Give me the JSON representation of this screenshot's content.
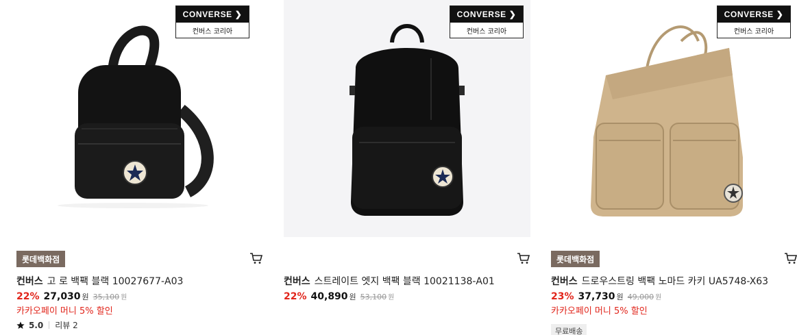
{
  "products": [
    {
      "logo": {
        "brand": "CONVERSE",
        "region": "컨버스 코리아"
      },
      "store_badge": "롯데백화점",
      "brand": "컨버스",
      "name": "고 로 백팩 블랙 10027677-A03",
      "discount": "22%",
      "price": "27,030",
      "currency": "원",
      "original_price": "35,100",
      "promo": "카카오페이 머니 5% 할인",
      "rating": "5.0",
      "review_label": "리뷰 2",
      "bag_color": "#131313"
    },
    {
      "logo": {
        "brand": "CONVERSE",
        "region": "컨버스 코리아"
      },
      "store_badge": "",
      "brand": "컨버스",
      "name": "스트레이트 엣지 백팩 블랙 10021138-A01",
      "discount": "22%",
      "price": "40,890",
      "currency": "원",
      "original_price": "53,100",
      "promo": "",
      "bag_color": "#101010"
    },
    {
      "logo": {
        "brand": "CONVERSE",
        "region": "컨버스 코리아"
      },
      "store_badge": "롯데백화점",
      "brand": "컨버스",
      "name": "드로우스트링 백팩 노마드 카키 UA5748-X63",
      "discount": "23%",
      "price": "37,730",
      "currency": "원",
      "original_price": "49,000",
      "promo": "카카오페이 머니 5% 할인",
      "shipping_tag": "무료배송",
      "bag_color": "#cfb48c"
    }
  ],
  "colors": {
    "accent_red": "#e1251b",
    "badge_brown": "#7a6a60"
  },
  "icons": {
    "cart": "cart-icon",
    "star": "star-icon",
    "arrow": "converse-arrow-icon"
  }
}
